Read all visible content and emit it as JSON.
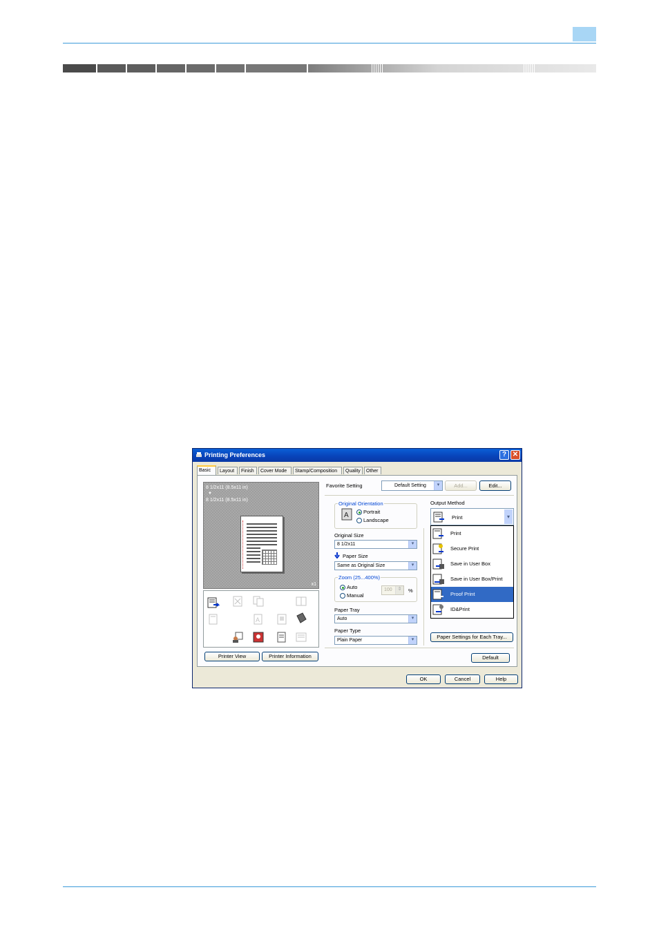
{
  "dialog": {
    "title": "Printing Preferences",
    "help_glyph": "?",
    "close_glyph": "✕",
    "tabs": [
      "Basic",
      "Layout",
      "Finish",
      "Cover Mode",
      "Stamp/Composition",
      "Quality",
      "Other"
    ],
    "preview": {
      "line1": "8 1/2x11 (8.5x11 in)",
      "arrow": "▼",
      "line2": "8 1/2x11 (8.5x11 in)",
      "copies": "x1"
    },
    "printer_view_label": "Printer View",
    "printer_info_label": "Printer Information",
    "favorite": {
      "label": "Favorite Setting",
      "value": "Default Setting",
      "add_label": "Add...",
      "edit_label": "Edit..."
    },
    "orientation": {
      "group_label": "Original Orientation",
      "portrait": "Portrait",
      "landscape": "Landscape"
    },
    "original_size": {
      "label": "Original Size",
      "value": "8 1/2x11"
    },
    "paper_size": {
      "label": "Paper Size",
      "value": "Same as Original Size"
    },
    "zoom": {
      "group_label": "Zoom (25...400%)",
      "auto": "Auto",
      "manual": "Manual",
      "value": "100",
      "unit": "%"
    },
    "paper_tray": {
      "label": "Paper Tray",
      "value": "Auto"
    },
    "paper_type": {
      "label": "Paper Type",
      "value": "Plain Paper"
    },
    "output_method": {
      "label": "Output Method",
      "selected": "Print",
      "options": [
        "Print",
        "Secure Print",
        "Save in User Box",
        "Save in User Box/Print",
        "Proof Print",
        "ID&Print"
      ],
      "highlighted_index": 4
    },
    "paper_settings_each_tray_label": "Paper Settings for Each Tray...",
    "default_label": "Default",
    "ok_label": "OK",
    "cancel_label": "Cancel",
    "help_label": "Help"
  }
}
